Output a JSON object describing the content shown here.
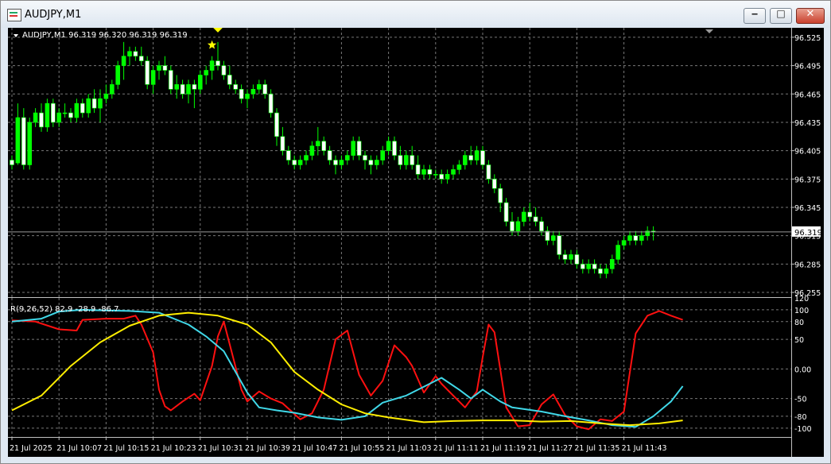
{
  "window": {
    "title": "AUDJPY,M1"
  },
  "window_buttons": {
    "minimize": "‒",
    "maximize": "□",
    "close": "✕"
  },
  "main_chart": {
    "header": "AUDJPY,M1  96.319 96.320 96.319 96.319",
    "current_price_label": "96.319",
    "price_ticks": [
      "96.525",
      "96.495",
      "96.465",
      "96.435",
      "96.405",
      "96.375",
      "96.345",
      "96.315",
      "96.285",
      "96.255"
    ],
    "colors": {
      "background": "#000000",
      "grid": "#787878",
      "bull": "#00ff00",
      "bear": "#ffffff",
      "axis_text": "#ffffff",
      "signal": "#ffff00"
    }
  },
  "indicator": {
    "header": "R(9,26,52) 82.9 -28.9 -86.7",
    "level_ticks": [
      "120",
      "100",
      "80",
      "50",
      "0.00",
      "-50",
      "-80",
      "-100"
    ],
    "series_colors": {
      "fast": "#ff1010",
      "mid": "#40d8e8",
      "slow": "#ffee00"
    }
  },
  "time_ticks": [
    "21 Jul 2025",
    "21 Jul 10:07",
    "21 Jul 10:15",
    "21 Jul 10:23",
    "21 Jul 10:31",
    "21 Jul 10:39",
    "21 Jul 10:47",
    "21 Jul 10:55",
    "21 Jul 11:03",
    "21 Jul 11:11",
    "21 Jul 11:19",
    "21 Jul 11:27",
    "21 Jul 11:35",
    "21 Jul 11:43"
  ],
  "chart_data": [
    {
      "type": "candlestick",
      "symbol": "AUDJPY",
      "timeframe": "M1",
      "ylim": [
        96.25,
        96.535
      ],
      "grid": true,
      "current_price": 96.319,
      "signal_markers": [
        {
          "kind": "star",
          "index": 34
        },
        {
          "kind": "down-arrow",
          "index": 35
        }
      ],
      "ohlc": [
        [
          96.395,
          96.4,
          96.385,
          96.39
        ],
        [
          96.392,
          96.455,
          96.39,
          96.44
        ],
        [
          96.44,
          96.45,
          96.385,
          96.39
        ],
        [
          96.39,
          96.44,
          96.385,
          96.435
        ],
        [
          96.435,
          96.45,
          96.43,
          96.445
        ],
        [
          96.445,
          96.455,
          96.425,
          96.43
        ],
        [
          96.43,
          96.46,
          96.425,
          96.455
        ],
        [
          96.455,
          96.46,
          96.43,
          96.435
        ],
        [
          96.435,
          96.45,
          96.43,
          96.445
        ],
        [
          96.445,
          96.455,
          96.44,
          96.445
        ],
        [
          96.445,
          96.45,
          96.435,
          96.44
        ],
        [
          96.44,
          96.46,
          96.435,
          96.455
        ],
        [
          96.455,
          96.46,
          96.44,
          96.445
        ],
        [
          96.445,
          96.465,
          96.44,
          96.46
        ],
        [
          96.46,
          96.47,
          96.445,
          96.45
        ],
        [
          96.45,
          96.47,
          96.435,
          96.46
        ],
        [
          96.46,
          96.475,
          96.455,
          96.465
        ],
        [
          96.465,
          96.48,
          96.46,
          96.475
        ],
        [
          96.475,
          96.5,
          96.47,
          96.495
        ],
        [
          96.495,
          96.52,
          96.48,
          96.505
        ],
        [
          96.505,
          96.515,
          96.495,
          96.51
        ],
        [
          96.51,
          96.515,
          96.5,
          96.505
        ],
        [
          96.505,
          96.515,
          96.495,
          96.5
        ],
        [
          96.5,
          96.505,
          96.47,
          96.475
        ],
        [
          96.475,
          96.495,
          96.465,
          96.49
        ],
        [
          96.49,
          96.5,
          96.48,
          96.495
        ],
        [
          96.495,
          96.505,
          96.485,
          96.49
        ],
        [
          96.49,
          96.495,
          96.465,
          96.47
        ],
        [
          96.47,
          96.485,
          96.46,
          96.475
        ],
        [
          96.475,
          96.48,
          96.46,
          96.465
        ],
        [
          96.465,
          96.48,
          96.455,
          96.475
        ],
        [
          96.475,
          96.48,
          96.45,
          96.47
        ],
        [
          96.47,
          96.49,
          96.465,
          96.485
        ],
        [
          96.485,
          96.495,
          96.475,
          96.49
        ],
        [
          96.49,
          96.505,
          96.48,
          96.5
        ],
        [
          96.5,
          96.52,
          96.49,
          96.495
        ],
        [
          96.495,
          96.5,
          96.48,
          96.485
        ],
        [
          96.485,
          96.495,
          96.47,
          96.475
        ],
        [
          96.475,
          96.48,
          96.465,
          96.47
        ],
        [
          96.47,
          96.475,
          96.455,
          96.46
        ],
        [
          96.46,
          96.47,
          96.45,
          96.465
        ],
        [
          96.465,
          96.475,
          96.46,
          96.47
        ],
        [
          96.47,
          96.48,
          96.465,
          96.475
        ],
        [
          96.475,
          96.48,
          96.46,
          96.465
        ],
        [
          96.465,
          96.47,
          96.44,
          96.445
        ],
        [
          96.445,
          96.45,
          96.41,
          96.42
        ],
        [
          96.42,
          96.43,
          96.4,
          96.405
        ],
        [
          96.405,
          96.41,
          96.39,
          96.395
        ],
        [
          96.395,
          96.4,
          96.385,
          96.39
        ],
        [
          96.39,
          96.4,
          96.385,
          96.395
        ],
        [
          96.395,
          96.405,
          96.39,
          96.4
        ],
        [
          96.4,
          96.415,
          96.395,
          96.41
        ],
        [
          96.41,
          96.43,
          96.4,
          96.415
        ],
        [
          96.415,
          96.42,
          96.4,
          96.405
        ],
        [
          96.405,
          96.41,
          96.39,
          96.395
        ],
        [
          96.395,
          96.4,
          96.38,
          96.39
        ],
        [
          96.39,
          96.4,
          96.385,
          96.395
        ],
        [
          96.395,
          96.405,
          96.39,
          96.4
        ],
        [
          96.4,
          96.42,
          96.395,
          96.415
        ],
        [
          96.415,
          96.42,
          96.395,
          96.4
        ],
        [
          96.4,
          96.405,
          96.385,
          96.395
        ],
        [
          96.395,
          96.4,
          96.38,
          96.39
        ],
        [
          96.39,
          96.4,
          96.385,
          96.395
        ],
        [
          96.395,
          96.41,
          96.39,
          96.405
        ],
        [
          96.405,
          96.42,
          96.4,
          96.415
        ],
        [
          96.415,
          96.42,
          96.395,
          96.4
        ],
        [
          96.4,
          96.41,
          96.385,
          96.39
        ],
        [
          96.39,
          96.405,
          96.385,
          96.4
        ],
        [
          96.4,
          96.41,
          96.385,
          96.39
        ],
        [
          96.39,
          96.4,
          96.375,
          96.38
        ],
        [
          96.38,
          96.39,
          96.375,
          96.385
        ],
        [
          96.385,
          96.39,
          96.375,
          96.38
        ],
        [
          96.38,
          96.385,
          96.375,
          96.38
        ],
        [
          96.38,
          96.385,
          96.37,
          96.375
        ],
        [
          96.375,
          96.385,
          96.37,
          96.38
        ],
        [
          96.38,
          96.39,
          96.375,
          96.385
        ],
        [
          96.385,
          96.395,
          96.38,
          96.39
        ],
        [
          96.39,
          96.405,
          96.385,
          96.4
        ],
        [
          96.4,
          96.41,
          96.39,
          96.395
        ],
        [
          96.395,
          96.41,
          96.39,
          96.405
        ],
        [
          96.405,
          96.41,
          96.385,
          96.39
        ],
        [
          96.39,
          96.395,
          96.37,
          96.375
        ],
        [
          96.375,
          96.38,
          96.36,
          96.365
        ],
        [
          96.365,
          96.37,
          96.34,
          96.35
        ],
        [
          96.35,
          96.355,
          96.325,
          96.33
        ],
        [
          96.33,
          96.34,
          96.315,
          96.32
        ],
        [
          96.32,
          96.335,
          96.315,
          96.33
        ],
        [
          96.33,
          96.345,
          96.325,
          96.34
        ],
        [
          96.34,
          96.35,
          96.33,
          96.335
        ],
        [
          96.335,
          96.345,
          96.325,
          96.33
        ],
        [
          96.33,
          96.335,
          96.315,
          96.32
        ],
        [
          96.32,
          96.325,
          96.305,
          96.31
        ],
        [
          96.31,
          96.32,
          96.305,
          96.315
        ],
        [
          96.315,
          96.32,
          96.29,
          96.295
        ],
        [
          96.295,
          96.3,
          96.285,
          96.29
        ],
        [
          96.29,
          96.3,
          96.285,
          96.295
        ],
        [
          96.295,
          96.3,
          96.28,
          96.285
        ],
        [
          96.285,
          96.29,
          96.275,
          96.28
        ],
        [
          96.28,
          96.29,
          96.275,
          96.285
        ],
        [
          96.285,
          96.29,
          96.275,
          96.28
        ],
        [
          96.28,
          96.285,
          96.27,
          96.275
        ],
        [
          96.275,
          96.285,
          96.27,
          96.28
        ],
        [
          96.28,
          96.295,
          96.275,
          96.29
        ],
        [
          96.29,
          96.31,
          96.285,
          96.305
        ],
        [
          96.305,
          96.315,
          96.3,
          96.31
        ],
        [
          96.31,
          96.32,
          96.305,
          96.315
        ],
        [
          96.315,
          96.32,
          96.305,
          96.31
        ],
        [
          96.31,
          96.32,
          96.305,
          96.315
        ],
        [
          96.315,
          96.325,
          96.31,
          96.32
        ],
        [
          96.32,
          96.325,
          96.31,
          96.319
        ]
      ]
    },
    {
      "type": "line",
      "levels": [
        100,
        80,
        50,
        0,
        -50,
        -80,
        -100
      ],
      "ylim": [
        -115,
        120
      ],
      "grid": true,
      "x_count": 115,
      "series": [
        {
          "color": "#ff1010",
          "points": [
            [
              0,
              82
            ],
            [
              4,
              80
            ],
            [
              8,
              67
            ],
            [
              11,
              65
            ],
            [
              12,
              83
            ],
            [
              16,
              85
            ],
            [
              19,
              85
            ],
            [
              21,
              90
            ],
            [
              22,
              75
            ],
            [
              24,
              28
            ],
            [
              25,
              -35
            ],
            [
              26,
              -63
            ],
            [
              27,
              -70
            ],
            [
              29,
              -55
            ],
            [
              31,
              -42
            ],
            [
              32,
              -53
            ],
            [
              34,
              5
            ],
            [
              35,
              55
            ],
            [
              36,
              80
            ],
            [
              37,
              42
            ],
            [
              39,
              -35
            ],
            [
              40,
              -55
            ],
            [
              42,
              -38
            ],
            [
              44,
              -50
            ],
            [
              46,
              -58
            ],
            [
              49,
              -85
            ],
            [
              51,
              -75
            ],
            [
              53,
              -35
            ],
            [
              55,
              50
            ],
            [
              57,
              65
            ],
            [
              59,
              -10
            ],
            [
              61,
              -45
            ],
            [
              63,
              -20
            ],
            [
              65,
              40
            ],
            [
              67,
              20
            ],
            [
              68,
              5
            ],
            [
              70,
              -40
            ],
            [
              72,
              -12
            ],
            [
              73,
              -25
            ],
            [
              75,
              -45
            ],
            [
              77,
              -65
            ],
            [
              79,
              -38
            ],
            [
              80,
              20
            ],
            [
              81,
              75
            ],
            [
              82,
              62
            ],
            [
              84,
              -65
            ],
            [
              86,
              -97
            ],
            [
              88,
              -95
            ],
            [
              90,
              -60
            ],
            [
              92,
              -43
            ],
            [
              94,
              -78
            ],
            [
              96,
              -97
            ],
            [
              98,
              -102
            ],
            [
              100,
              -85
            ],
            [
              102,
              -88
            ],
            [
              104,
              -72
            ],
            [
              106,
              60
            ],
            [
              108,
              90
            ],
            [
              110,
              98
            ],
            [
              112,
              90
            ],
            [
              114,
              83
            ]
          ]
        },
        {
          "color": "#40d8e8",
          "points": [
            [
              0,
              80
            ],
            [
              5,
              85
            ],
            [
              8,
              97
            ],
            [
              12,
              100
            ],
            [
              15,
              99
            ],
            [
              20,
              98
            ],
            [
              25,
              95
            ],
            [
              30,
              75
            ],
            [
              33,
              55
            ],
            [
              36,
              30
            ],
            [
              40,
              -40
            ],
            [
              42,
              -65
            ],
            [
              45,
              -70
            ],
            [
              48,
              -74
            ],
            [
              52,
              -82
            ],
            [
              56,
              -86
            ],
            [
              60,
              -80
            ],
            [
              63,
              -57
            ],
            [
              67,
              -45
            ],
            [
              71,
              -25
            ],
            [
              73,
              -15
            ],
            [
              76,
              -35
            ],
            [
              78,
              -50
            ],
            [
              80,
              -35
            ],
            [
              83,
              -55
            ],
            [
              85,
              -65
            ],
            [
              90,
              -72
            ],
            [
              94,
              -80
            ],
            [
              98,
              -87
            ],
            [
              102,
              -95
            ],
            [
              106,
              -98
            ],
            [
              109,
              -80
            ],
            [
              112,
              -55
            ],
            [
              114,
              -29
            ]
          ]
        },
        {
          "color": "#ffee00",
          "points": [
            [
              0,
              -70
            ],
            [
              5,
              -45
            ],
            [
              10,
              5
            ],
            [
              15,
              45
            ],
            [
              20,
              73
            ],
            [
              25,
              90
            ],
            [
              30,
              95
            ],
            [
              35,
              90
            ],
            [
              40,
              75
            ],
            [
              44,
              45
            ],
            [
              48,
              -5
            ],
            [
              52,
              -35
            ],
            [
              56,
              -60
            ],
            [
              60,
              -75
            ],
            [
              64,
              -82
            ],
            [
              70,
              -90
            ],
            [
              75,
              -88
            ],
            [
              80,
              -87
            ],
            [
              85,
              -87
            ],
            [
              90,
              -89
            ],
            [
              95,
              -88
            ],
            [
              100,
              -92
            ],
            [
              105,
              -95
            ],
            [
              110,
              -92
            ],
            [
              114,
              -87
            ]
          ]
        }
      ]
    }
  ]
}
